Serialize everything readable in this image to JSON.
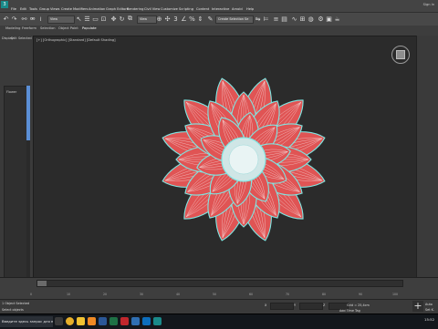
{
  "menubar": {
    "logo_letter": "3",
    "items": [
      "File",
      "Edit",
      "Tools",
      "Group",
      "Views",
      "Create",
      "Modifiers",
      "Animation",
      "Graph Editors",
      "Rendering",
      "Civil View",
      "Customize",
      "Scripting",
      "Content",
      "Interactive",
      "Arnold",
      "Help"
    ],
    "signin": "Sign In",
    "window_controls": [
      "–",
      "□",
      "✕"
    ]
  },
  "toolbar": {
    "view_dropdown": "View",
    "selection_set": "Create Selection Se",
    "icons": [
      "undo-icon",
      "redo-icon",
      "link-icon",
      "unlink-icon",
      "bind-icon",
      "select-filter-icon",
      "select-icon",
      "select-by-name-icon",
      "region-select-icon",
      "window-crossing-icon",
      "move-icon",
      "rotate-icon",
      "scale-icon",
      "reference-coord-icon",
      "pivot-icon",
      "select-manipulate-icon",
      "keyboard-shortcut-icon",
      "snaps-icon",
      "angle-snap-icon",
      "percent-snap-icon",
      "spinner-snap-icon",
      "edit-named-sel-icon",
      "mirror-icon",
      "align-icon",
      "layer-icon",
      "toggle-ribbon-icon",
      "curve-editor-icon",
      "schematic-icon",
      "material-editor-icon",
      "render-setup-icon",
      "render-frame-icon",
      "render-icon"
    ]
  },
  "ribbon": {
    "tabs": [
      "Modeling",
      "Freeform",
      "Selection",
      "Object Paint",
      "Populate"
    ],
    "active": "Populate"
  },
  "scene_explorer": {
    "tabs": [
      "Display",
      "Edit",
      "Selected"
    ],
    "tree_item": "Flower"
  },
  "viewport": {
    "label": "[+] [Orthographic] [Standard] [Default Shading]",
    "object": "flower"
  },
  "timeline": {
    "ticks": [
      "0",
      "10",
      "20",
      "30",
      "40",
      "50",
      "60",
      "70",
      "80",
      "90",
      "100"
    ]
  },
  "status": {
    "selection": "1 Object Selected",
    "prompt": "Select objects",
    "x_label": "X",
    "x_value": "",
    "y_label": "Y",
    "y_value": "",
    "z_label": "Z",
    "z_value": "",
    "grid": "Grid = 25,4cm",
    "add_time_tag": "Add Time Tag",
    "auto": "Auto",
    "set_key": "Set K."
  },
  "taskbar": {
    "search_text": "Введите здесь запрос для поиска",
    "apps": [
      "chrome",
      "explorer",
      "vlc",
      "word",
      "excel",
      "acrobat",
      "photoshop",
      "edge",
      "3dsmax"
    ],
    "time": "15:52"
  },
  "colors": {
    "petal": "#e05454",
    "petal_outline": "#7fe6e2",
    "center": "#cfe6e6",
    "accent": "#1a8a8a"
  }
}
